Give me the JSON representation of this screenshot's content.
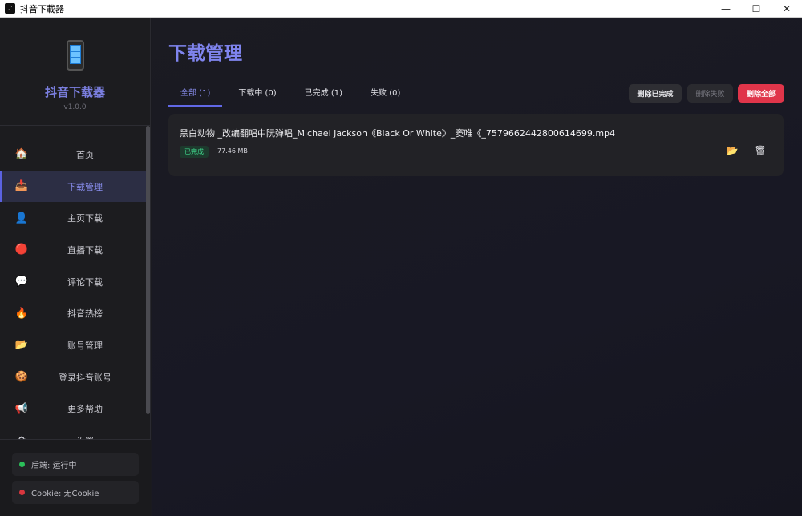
{
  "window": {
    "title": "抖音下載器",
    "controls": {
      "minimize": "—",
      "maximize": "☐",
      "close": "✕"
    }
  },
  "sidebar": {
    "app_name": "抖音下载器",
    "version": "v1.0.0",
    "items": [
      {
        "label": "首页",
        "icon": "home-icon",
        "glyph": "🏠"
      },
      {
        "label": "下载管理",
        "icon": "download-tray-icon",
        "glyph": "📥",
        "active": true
      },
      {
        "label": "主页下载",
        "icon": "user-icon",
        "glyph": "👤"
      },
      {
        "label": "直播下载",
        "icon": "red-circle-icon",
        "glyph": "🔴"
      },
      {
        "label": "评论下载",
        "icon": "comment-icon",
        "glyph": "💬"
      },
      {
        "label": "抖音热榜",
        "icon": "fire-icon",
        "glyph": "🔥"
      },
      {
        "label": "账号管理",
        "icon": "folder-icon",
        "glyph": "📂"
      },
      {
        "label": "登录抖音账号",
        "icon": "cookie-icon",
        "glyph": "🍪"
      },
      {
        "label": "更多帮助",
        "icon": "megaphone-icon",
        "glyph": "📢"
      },
      {
        "label": "设置",
        "icon": "gear-icon",
        "glyph": "⚙"
      }
    ],
    "status": {
      "backend": {
        "text": "后端: 运行中",
        "color": "#2bbf5a"
      },
      "cookie": {
        "text": "Cookie: 无Cookie",
        "color": "#d9363e"
      }
    }
  },
  "main": {
    "title": "下载管理",
    "tabs": [
      {
        "label": "全部 (1)",
        "active": true
      },
      {
        "label": "下载中 (0)"
      },
      {
        "label": "已完成 (1)"
      },
      {
        "label": "失败 (0)"
      }
    ],
    "actions": {
      "delete_completed": "删除已完成",
      "delete_failed": "删除失败",
      "delete_all": "删除全部"
    },
    "downloads": [
      {
        "filename": "黑白动物 _改编翻唱中阮弹唱_Michael Jackson《Black Or White》_窦唯《_7579662442800614699.mp4",
        "status": "已完成",
        "size": "77.46 MB"
      }
    ]
  },
  "colors": {
    "accent": "#7f84ee",
    "danger": "#e0354a",
    "success": "#3fd48a"
  }
}
